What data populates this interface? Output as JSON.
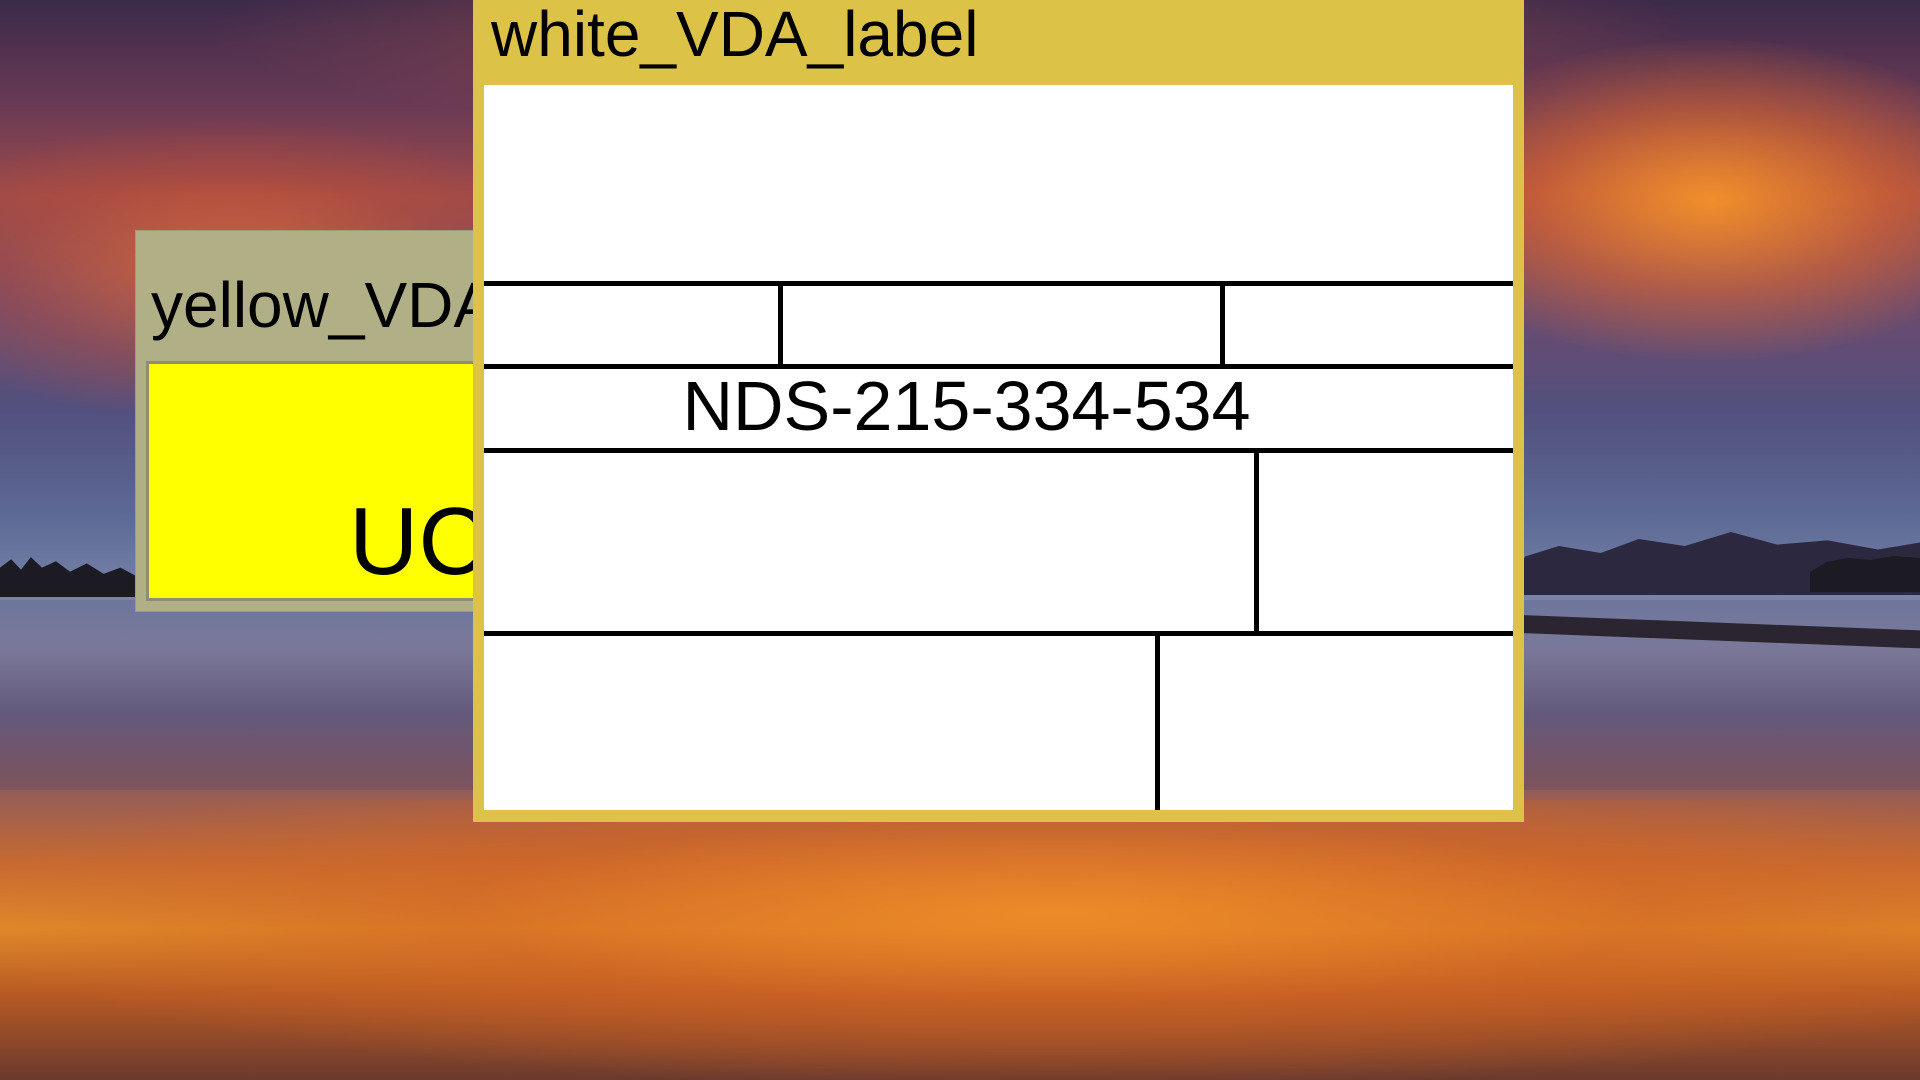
{
  "desktop": {
    "wallpaper": "sunset-lake-wallpaper"
  },
  "windows": {
    "yellow": {
      "title": "yellow_VDA_label",
      "body_text": "UC",
      "colors": {
        "frame": "#b1af85",
        "body": "#ffff00"
      }
    },
    "white": {
      "title": "white_VDA_label",
      "ndc_number": "NDS-215-334-534",
      "colors": {
        "frame": "#dcc348",
        "body": "#ffffff",
        "grid": "#000000"
      }
    }
  }
}
